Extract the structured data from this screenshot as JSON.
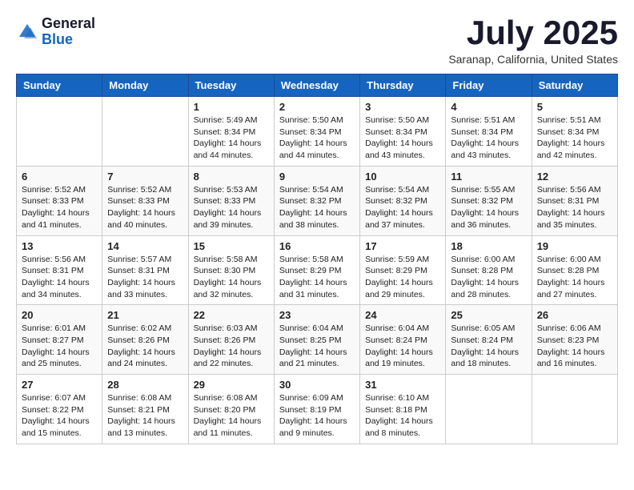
{
  "logo": {
    "general": "General",
    "blue": "Blue"
  },
  "title": "July 2025",
  "location": "Saranap, California, United States",
  "weekdays": [
    "Sunday",
    "Monday",
    "Tuesday",
    "Wednesday",
    "Thursday",
    "Friday",
    "Saturday"
  ],
  "weeks": [
    [
      {
        "day": "",
        "info": ""
      },
      {
        "day": "",
        "info": ""
      },
      {
        "day": "1",
        "info": "Sunrise: 5:49 AM\nSunset: 8:34 PM\nDaylight: 14 hours and 44 minutes."
      },
      {
        "day": "2",
        "info": "Sunrise: 5:50 AM\nSunset: 8:34 PM\nDaylight: 14 hours and 44 minutes."
      },
      {
        "day": "3",
        "info": "Sunrise: 5:50 AM\nSunset: 8:34 PM\nDaylight: 14 hours and 43 minutes."
      },
      {
        "day": "4",
        "info": "Sunrise: 5:51 AM\nSunset: 8:34 PM\nDaylight: 14 hours and 43 minutes."
      },
      {
        "day": "5",
        "info": "Sunrise: 5:51 AM\nSunset: 8:34 PM\nDaylight: 14 hours and 42 minutes."
      }
    ],
    [
      {
        "day": "6",
        "info": "Sunrise: 5:52 AM\nSunset: 8:33 PM\nDaylight: 14 hours and 41 minutes."
      },
      {
        "day": "7",
        "info": "Sunrise: 5:52 AM\nSunset: 8:33 PM\nDaylight: 14 hours and 40 minutes."
      },
      {
        "day": "8",
        "info": "Sunrise: 5:53 AM\nSunset: 8:33 PM\nDaylight: 14 hours and 39 minutes."
      },
      {
        "day": "9",
        "info": "Sunrise: 5:54 AM\nSunset: 8:32 PM\nDaylight: 14 hours and 38 minutes."
      },
      {
        "day": "10",
        "info": "Sunrise: 5:54 AM\nSunset: 8:32 PM\nDaylight: 14 hours and 37 minutes."
      },
      {
        "day": "11",
        "info": "Sunrise: 5:55 AM\nSunset: 8:32 PM\nDaylight: 14 hours and 36 minutes."
      },
      {
        "day": "12",
        "info": "Sunrise: 5:56 AM\nSunset: 8:31 PM\nDaylight: 14 hours and 35 minutes."
      }
    ],
    [
      {
        "day": "13",
        "info": "Sunrise: 5:56 AM\nSunset: 8:31 PM\nDaylight: 14 hours and 34 minutes."
      },
      {
        "day": "14",
        "info": "Sunrise: 5:57 AM\nSunset: 8:31 PM\nDaylight: 14 hours and 33 minutes."
      },
      {
        "day": "15",
        "info": "Sunrise: 5:58 AM\nSunset: 8:30 PM\nDaylight: 14 hours and 32 minutes."
      },
      {
        "day": "16",
        "info": "Sunrise: 5:58 AM\nSunset: 8:29 PM\nDaylight: 14 hours and 31 minutes."
      },
      {
        "day": "17",
        "info": "Sunrise: 5:59 AM\nSunset: 8:29 PM\nDaylight: 14 hours and 29 minutes."
      },
      {
        "day": "18",
        "info": "Sunrise: 6:00 AM\nSunset: 8:28 PM\nDaylight: 14 hours and 28 minutes."
      },
      {
        "day": "19",
        "info": "Sunrise: 6:00 AM\nSunset: 8:28 PM\nDaylight: 14 hours and 27 minutes."
      }
    ],
    [
      {
        "day": "20",
        "info": "Sunrise: 6:01 AM\nSunset: 8:27 PM\nDaylight: 14 hours and 25 minutes."
      },
      {
        "day": "21",
        "info": "Sunrise: 6:02 AM\nSunset: 8:26 PM\nDaylight: 14 hours and 24 minutes."
      },
      {
        "day": "22",
        "info": "Sunrise: 6:03 AM\nSunset: 8:26 PM\nDaylight: 14 hours and 22 minutes."
      },
      {
        "day": "23",
        "info": "Sunrise: 6:04 AM\nSunset: 8:25 PM\nDaylight: 14 hours and 21 minutes."
      },
      {
        "day": "24",
        "info": "Sunrise: 6:04 AM\nSunset: 8:24 PM\nDaylight: 14 hours and 19 minutes."
      },
      {
        "day": "25",
        "info": "Sunrise: 6:05 AM\nSunset: 8:24 PM\nDaylight: 14 hours and 18 minutes."
      },
      {
        "day": "26",
        "info": "Sunrise: 6:06 AM\nSunset: 8:23 PM\nDaylight: 14 hours and 16 minutes."
      }
    ],
    [
      {
        "day": "27",
        "info": "Sunrise: 6:07 AM\nSunset: 8:22 PM\nDaylight: 14 hours and 15 minutes."
      },
      {
        "day": "28",
        "info": "Sunrise: 6:08 AM\nSunset: 8:21 PM\nDaylight: 14 hours and 13 minutes."
      },
      {
        "day": "29",
        "info": "Sunrise: 6:08 AM\nSunset: 8:20 PM\nDaylight: 14 hours and 11 minutes."
      },
      {
        "day": "30",
        "info": "Sunrise: 6:09 AM\nSunset: 8:19 PM\nDaylight: 14 hours and 9 minutes."
      },
      {
        "day": "31",
        "info": "Sunrise: 6:10 AM\nSunset: 8:18 PM\nDaylight: 14 hours and 8 minutes."
      },
      {
        "day": "",
        "info": ""
      },
      {
        "day": "",
        "info": ""
      }
    ]
  ]
}
